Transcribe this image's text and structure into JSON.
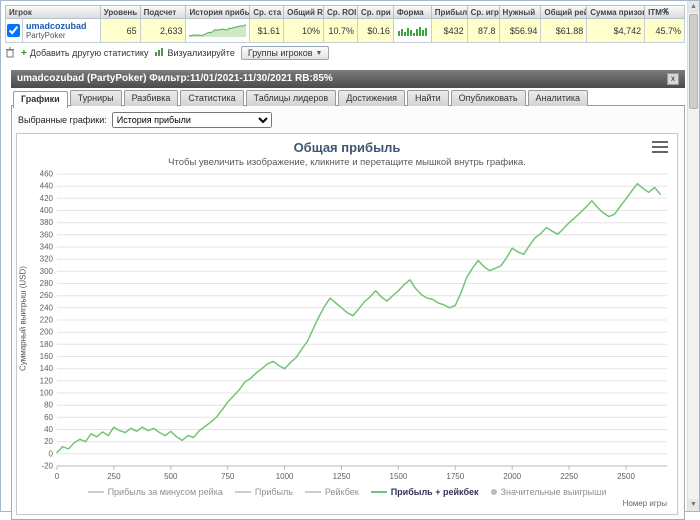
{
  "top_table": {
    "headers": [
      "Игрок",
      "Уровень",
      "Подсчет",
      "История прибыли",
      "Ср. ста",
      "Общий ROI",
      "Ср. ROI",
      "Ср. при",
      "Форма",
      "Прибыль",
      "Ср. игр",
      "Нужный",
      "Общий рейк",
      "Сумма призов",
      "ITM%"
    ],
    "row": {
      "player": "umadcozubad",
      "site": "PartyPoker",
      "level": "65",
      "count": "2,633",
      "avg_stake": "$1.61",
      "total_roi": "10%",
      "avg_roi": "10.7%",
      "avg_profit": "$0.16",
      "profit": "$432",
      "avg_games": "87.8",
      "needed": "$56.94",
      "total_rake": "$61.88",
      "prize_sum": "$4,742",
      "itm": "45.7%"
    },
    "form_bars": [
      5,
      7,
      4,
      8,
      6,
      3,
      7,
      9,
      6,
      8
    ],
    "close_label": "x"
  },
  "toolbar": {
    "add_stat": "Добавить другую статистику",
    "visualize": "Визуализируйте",
    "groups": "Группы игроков"
  },
  "panel": {
    "title": "umadcozubad (PartyPoker) Фильтр:11/01/2021-11/30/2021 RB:85%",
    "close_label": "x",
    "tabs": [
      {
        "label": "Графики"
      },
      {
        "label": "Турниры"
      },
      {
        "label": "Разбивка"
      },
      {
        "label": "Статистика"
      },
      {
        "label": "Таблицы лидеров"
      },
      {
        "label": "Достижения"
      },
      {
        "label": "Найти"
      },
      {
        "label": "Опубликовать"
      },
      {
        "label": "Аналитика"
      }
    ],
    "selected_graphs_label": "Выбранные графики:",
    "graph_select_value": "История прибыли"
  },
  "chart_data": {
    "type": "line",
    "title": "Общая прибыль",
    "subtitle": "Чтобы увеличить изображение, кликните и перетащите мышкой внутрь графика.",
    "ylabel": "Суммарный выигрыш (USD)",
    "xlabel": "Номер игры",
    "ylim": [
      -20,
      460
    ],
    "xlim": [
      0,
      2680
    ],
    "y_tick_step": 20,
    "x_ticks": [
      0,
      250,
      500,
      750,
      1000,
      1250,
      1500,
      1750,
      2000,
      2250,
      2500
    ],
    "grid": true,
    "legend_position": "bottom",
    "line_color": "#74c476",
    "series": [
      {
        "name": "Прибыль + рейкбек",
        "x_start": 0,
        "x_step": 25,
        "y": [
          2,
          12,
          8,
          18,
          24,
          20,
          33,
          28,
          36,
          30,
          44,
          38,
          35,
          42,
          37,
          44,
          38,
          42,
          35,
          30,
          37,
          28,
          22,
          30,
          27,
          38,
          45,
          52,
          60,
          72,
          85,
          95,
          105,
          118,
          124,
          133,
          140,
          148,
          152,
          145,
          140,
          150,
          158,
          172,
          185,
          205,
          225,
          242,
          256,
          248,
          240,
          232,
          227,
          238,
          250,
          258,
          268,
          258,
          251,
          260,
          268,
          278,
          286,
          272,
          262,
          256,
          254,
          248,
          245,
          240,
          244,
          265,
          290,
          305,
          318,
          308,
          301,
          305,
          309,
          322,
          338,
          332,
          328,
          342,
          355,
          362,
          372,
          366,
          361,
          370,
          380,
          388,
          397,
          406,
          416,
          405,
          396,
          390,
          394,
          407,
          419,
          432,
          444,
          436,
          430,
          438,
          427
        ]
      }
    ],
    "legend": [
      {
        "label": "Прибыль за минусом рейка",
        "enabled": false,
        "marker": "line"
      },
      {
        "label": "Прибыль",
        "enabled": false,
        "marker": "line"
      },
      {
        "label": "Рейкбек",
        "enabled": false,
        "marker": "line"
      },
      {
        "label": "Прибыль + рейкбек",
        "enabled": true,
        "marker": "line"
      },
      {
        "label": "Значительные выигрыши",
        "enabled": false,
        "marker": "circle"
      }
    ]
  }
}
